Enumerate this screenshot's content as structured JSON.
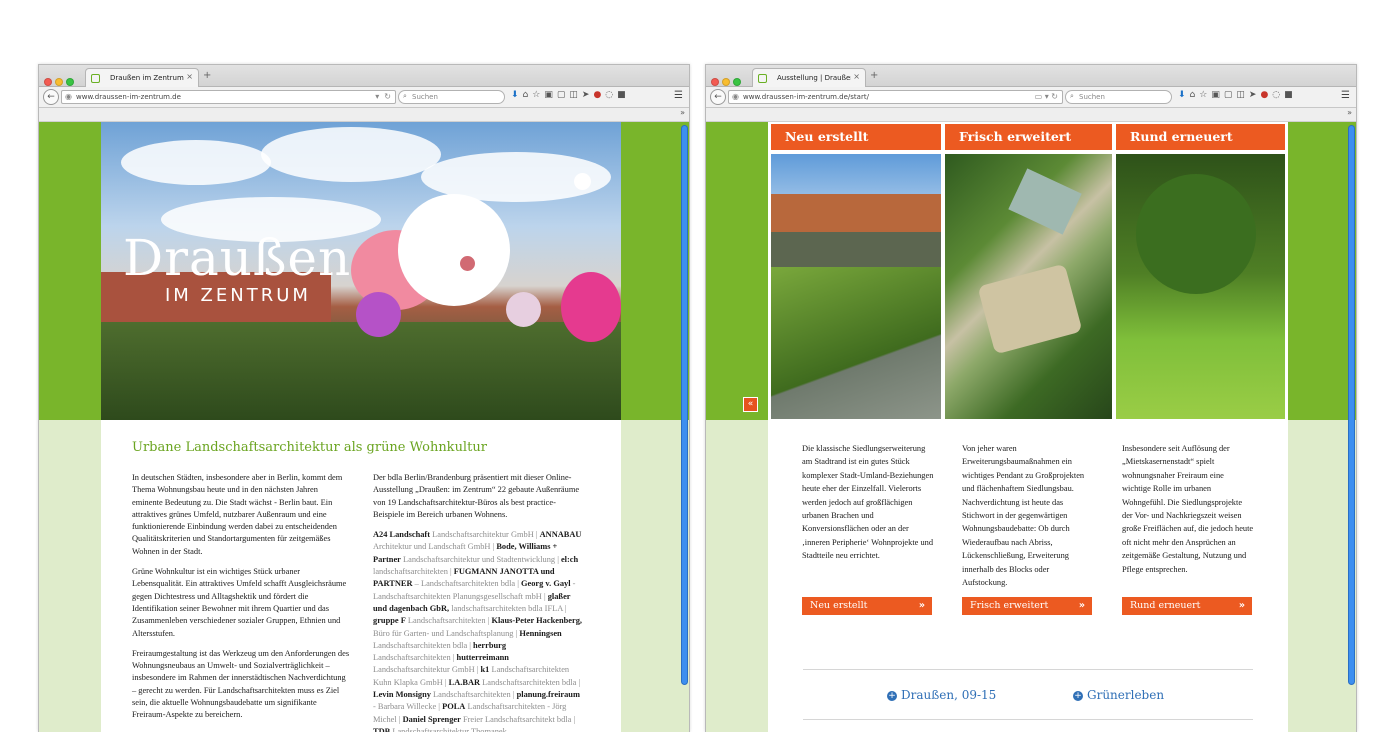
{
  "left": {
    "tab_title": "Draußen im Zentrum",
    "tab_close": "×",
    "new_tab": "+",
    "url": "www.draussen-im-zentrum.de",
    "search_placeholder": "Suchen",
    "logo_big": "Draußen",
    "logo_small": "IM ZENTRUM",
    "article_title": "Urbane Landschaftsarchitektur als grüne Wohnkultur",
    "col1_paragraphs": [
      "In deutschen Städten, insbesondere aber in Berlin, kommt dem Thema Wohnungsbau heute und in den nächsten Jahren eminente Bedeutung zu. Die Stadt wächst - Berlin baut. Ein attraktives grünes Umfeld, nutzbarer Außenraum und eine funktionierende Einbindung werden dabei zu entscheidenden Qualitätskriterien und Standortargumenten für zeitgemäßes Wohnen in der Stadt.",
      "Grüne Wohnkultur ist ein wichtiges Stück urbaner Lebensqualität. Ein attraktives Umfeld schafft Ausgleichsräume gegen Dichtestress und Alltagshektik und fördert die Identifikation seiner Bewohner mit ihrem Quartier und das Zusammenleben verschiedener sozialer Gruppen, Ethnien und Altersstufen.",
      "Freiraumgestaltung ist das Werkzeug um den Anforderungen des Wohnungsneubaus an Umwelt- und Sozialverträglichkeit – insbesondere im Rahmen der innerstädtischen Nachverdichtung – gerecht zu werden. Für Landschaftsarchitekten muss es Ziel sein, die aktuelle Wohnungsbaudebatte um signifikante Freiraum-Aspekte zu bereichern."
    ],
    "col2_intro": "Der bdla Berlin/Brandenburg präsentiert mit dieser Online-Ausstellung „Draußen: im Zentrum“ 22 gebaute Außenräume von 19 Landschaftsarchitektur-Büros als best practice-Beispiele im Bereich urbanen Wohnens.",
    "firms": [
      {
        "name": "A24 Landschaft",
        "desc": "Landschaftsarchitektur GmbH |"
      },
      {
        "name": "ANNABAU",
        "desc": "Architektur und Landschaft GmbH |"
      },
      {
        "name": "Bode, Williams + Partner",
        "desc": "Landschaftsarchitektur und Stadtentwicklung |"
      },
      {
        "name": "el:ch",
        "desc": "landschaftsarchitekten |"
      },
      {
        "name": "FUGMANN JANOTTA und PARTNER",
        "desc": "– Landschaftsarchitekten bdla |"
      },
      {
        "name": "Georg v. Gayl",
        "desc": "- Landschaftsarchitekten Planungsgesellschaft mbH |"
      },
      {
        "name": "glaßer und dagenbach GbR,",
        "desc": "landschaftsarchitekten bdla IFLA |"
      },
      {
        "name": "gruppe F",
        "desc": "Landschaftsarchitekten |"
      },
      {
        "name": "Klaus-Peter Hackenberg,",
        "desc": "Büro für Garten- und Landschaftsplanung |"
      },
      {
        "name": "Henningsen",
        "desc": "Landschaftsarchitekten bdla |"
      },
      {
        "name": "herrburg",
        "desc": "Landschaftsarchitekten |"
      },
      {
        "name": "hutterreimann",
        "desc": "Landschaftsarchitektur GmbH |"
      },
      {
        "name": "k1",
        "desc": "Landschaftsarchitekten Kuhn Klapka GmbH |"
      },
      {
        "name": "LA.BAR",
        "desc": "Landschaftsarchitekten bdla |"
      },
      {
        "name": "Levin Monsigny",
        "desc": "Landschaftsarchitekten |"
      },
      {
        "name": "planung.freiraum",
        "desc": "- Barbara Willecke |"
      },
      {
        "name": "POLA",
        "desc": "Landschaftsarchitekten - Jörg Michel |"
      },
      {
        "name": "Daniel Sprenger",
        "desc": "Freier Landschaftsarchitekt bdla |"
      },
      {
        "name": "TDB",
        "desc": "Landschaftsarchitektur Thomanek"
      }
    ]
  },
  "right": {
    "tab_title": "Ausstellung | Draußen im ...",
    "tab_close": "×",
    "new_tab": "+",
    "url": "www.draussen-im-zentrum.de/start/",
    "search_placeholder": "Suchen",
    "collapse_glyph": "«",
    "columns": [
      {
        "heading": "Neu erstellt",
        "text": "Die klassische Siedlungserweiterung am Stadtrand ist ein gutes Stück komplexer Stadt-Umland-Beziehungen heute eher der Einzelfall. Vielerorts werden jedoch auf großflächigen urbanen Brachen und Konversionsflächen oder an der ‚inneren Peripherie‘ Wohnprojekte und Stadtteile neu errichtet.",
        "button": "Neu erstellt"
      },
      {
        "heading": "Frisch erweitert",
        "text": "Von jeher waren Erweiterungsbaumaßnahmen ein wichtiges Pendant zu Großprojekten und flächenhaftem Siedlungsbau. Nachverdichtung ist heute das Stichwort in der gegenwärtigen Wohnungsbaudebatte: Ob durch Wiederaufbau nach Abriss, Lückenschließung, Erweiterung innerhalb des Blocks oder Aufstockung.",
        "button": "Frisch erweitert"
      },
      {
        "heading": "Rund erneuert",
        "text": "Insbesondere seit Auflösung der „Mietskasernenstadt“ spielt wohnungsnaher Freiraum eine wichtige Rolle im urbanen Wohngefühl. Die Siedlungsprojekte der Vor- und Nachkriegszeit weisen große Freiflächen auf, die jedoch heute oft nicht mehr den Ansprüchen an zeitgemäße Gestaltung, Nutzung und Pflege entsprechen.",
        "button": "Rund erneuert"
      }
    ],
    "button_arrow": "»",
    "footer_links": [
      "Draußen, 09-15",
      "Grünerleben"
    ],
    "plus_glyph": "+"
  },
  "colors": {
    "green": "#79b52b",
    "pale_green": "#dfeccb",
    "orange": "#ec5a21",
    "title_green": "#6aa420",
    "link_blue": "#2f6fb6"
  }
}
